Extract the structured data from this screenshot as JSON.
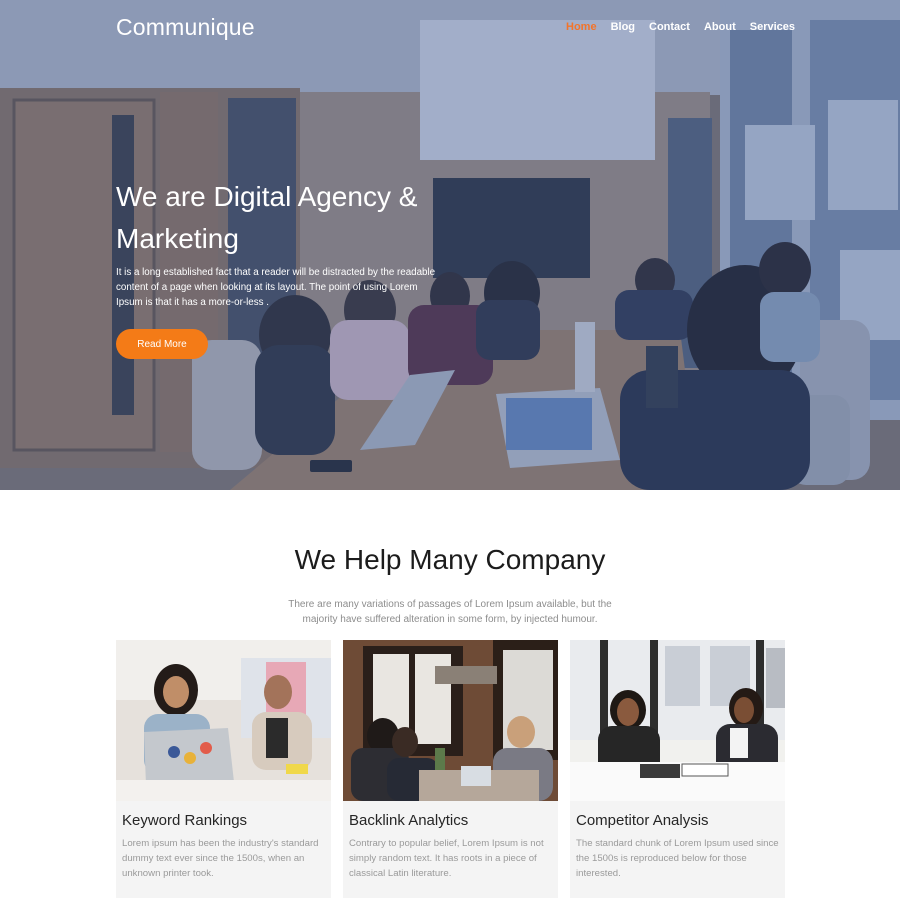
{
  "brand": {
    "name": "Communique"
  },
  "nav": {
    "items": [
      {
        "label": "Home",
        "active": true
      },
      {
        "label": "Blog",
        "active": false
      },
      {
        "label": "Contact",
        "active": false
      },
      {
        "label": "About",
        "active": false
      },
      {
        "label": "Services",
        "active": false
      }
    ]
  },
  "hero": {
    "title": "We are Digital Agency & Marketing",
    "text": "It is a long established fact that a reader will be distracted by the readable content of a page when looking at its layout. The point of using Lorem Ipsum is that it has a more-or-less .",
    "button_label": "Read More"
  },
  "section": {
    "title": "We Help Many Company",
    "subtitle": "There are many variations of passages of Lorem Ipsum available, but the majority have suffered alteration in some form, by injected humour."
  },
  "cards": [
    {
      "title": "Keyword Rankings",
      "text": "Lorem ipsum has been the industry's standard dummy text ever since the 1500s, when an unknown printer took."
    },
    {
      "title": "Backlink Analytics",
      "text": "Contrary to popular belief, Lorem Ipsum is not simply random text. It has roots in a piece of classical Latin literature."
    },
    {
      "title": "Competitor Analysis",
      "text": "The standard chunk of Lorem Ipsum used since the 1500s is reproduced below for those interested."
    }
  ],
  "colors": {
    "accent": "#f47b17",
    "active_nav": "#f3742a",
    "hero_overlay": "#3a548c",
    "card_bg": "#f4f4f4"
  }
}
